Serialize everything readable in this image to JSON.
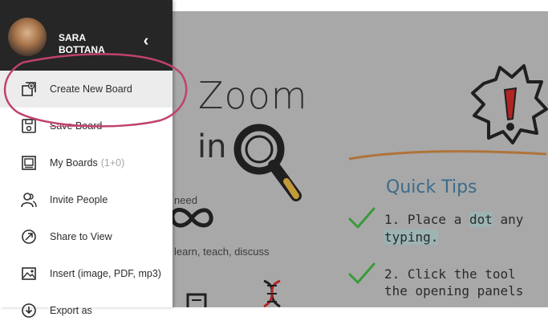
{
  "user": {
    "name_line1": "SARA",
    "name_line2": "BOTTANA"
  },
  "collapse_glyph": "‹",
  "menu": [
    {
      "label": "Create New Board",
      "icon": "add-board-icon",
      "active": true
    },
    {
      "label": "Save Board",
      "icon": "save-icon"
    },
    {
      "label": "My Boards",
      "count": "(1+0)",
      "icon": "boards-icon"
    },
    {
      "label": "Invite People",
      "icon": "people-icon"
    },
    {
      "label": "Share to View",
      "icon": "share-icon"
    },
    {
      "label": "Insert (image, PDF, mp3)",
      "icon": "insert-media-icon"
    },
    {
      "label": "Export as",
      "icon": "export-icon"
    }
  ],
  "board": {
    "zoom_word": "Zoom",
    "in_word": "in",
    "need_word": "need",
    "learn_word": "learn, teach, discuss",
    "quick_tips_title": "Quick Tips",
    "tip1_line1_pre": "1. Place a ",
    "tip1_line1_hl": "dot",
    "tip1_line1_post": " any",
    "tip1_line2": "typing.",
    "tip2_line1": "2. Click the tool",
    "tip2_line2": "the opening panels"
  },
  "colors": {
    "header_bg": "#262626",
    "board_bg": "#a8a8a8",
    "annotation": "#c0426a",
    "tips_blue": "#3d6b8a"
  }
}
